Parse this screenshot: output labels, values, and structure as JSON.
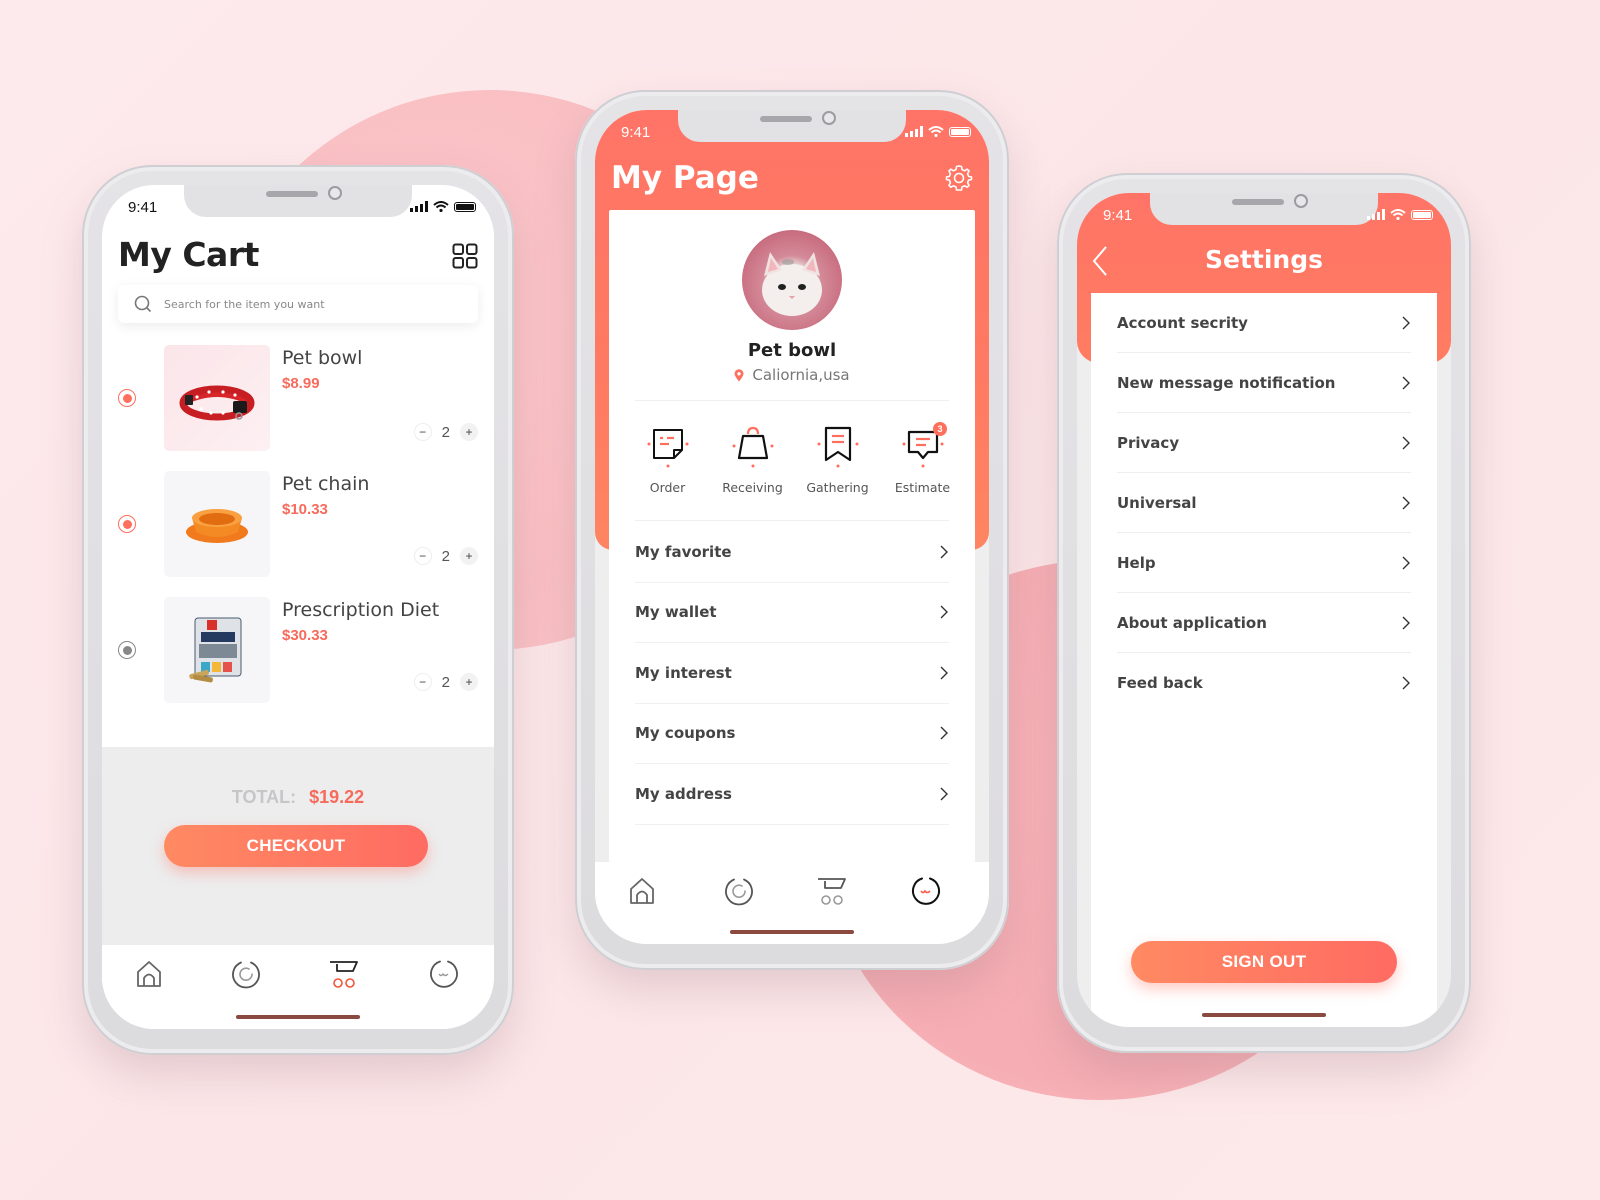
{
  "colors": {
    "accent": "#ff7466",
    "accent_gradient_start": "#ff8a62",
    "accent_gradient_end": "#ff6b62",
    "price": "#f76b5c",
    "home_indicator": "#8b4a3f"
  },
  "status_bar": {
    "time": "9:41"
  },
  "cart_screen": {
    "title": "My Cart",
    "view_toggle_icon": "grid-icon",
    "search": {
      "placeholder": "Search for the item you want",
      "value": ""
    },
    "items": [
      {
        "name": "Pet bowl",
        "price": "$8.99",
        "quantity": "2",
        "selected": true,
        "image": "red-collar"
      },
      {
        "name": "Pet chain",
        "price": "$10.33",
        "quantity": "2",
        "selected": true,
        "image": "orange-bowl"
      },
      {
        "name": "Prescription Diet",
        "price": "$30.33",
        "quantity": "2",
        "selected": false,
        "image": "food-bag"
      }
    ],
    "total_label": "TOTAL:",
    "total_value": "$19.22",
    "checkout_label": "CHECKOUT",
    "tabs": [
      {
        "icon": "home-icon",
        "active": false
      },
      {
        "icon": "discover-icon",
        "active": false
      },
      {
        "icon": "cart-icon",
        "active": true
      },
      {
        "icon": "profile-icon",
        "active": false
      }
    ]
  },
  "mypage_screen": {
    "title": "My Page",
    "settings_icon": "gear-icon",
    "profile": {
      "name": "Pet bowl",
      "location": "Caliornia,usa"
    },
    "quick_actions": [
      {
        "label": "Order",
        "icon": "order-icon"
      },
      {
        "label": "Receiving",
        "icon": "bag-icon"
      },
      {
        "label": "Gathering",
        "icon": "bookmark-icon"
      },
      {
        "label": "Estimate",
        "icon": "comment-icon",
        "badge": "3"
      }
    ],
    "menu": [
      {
        "label": "My favorite"
      },
      {
        "label": "My wallet"
      },
      {
        "label": "My interest"
      },
      {
        "label": "My coupons"
      },
      {
        "label": "My address"
      }
    ],
    "tabs": [
      {
        "icon": "home-icon",
        "active": false
      },
      {
        "icon": "discover-icon",
        "active": false
      },
      {
        "icon": "cart-icon",
        "active": false
      },
      {
        "icon": "profile-icon",
        "active": true
      }
    ]
  },
  "settings_screen": {
    "title": "Settings",
    "back_icon": "chevron-left-icon",
    "items": [
      {
        "label": "Account secrity"
      },
      {
        "label": "New message notification"
      },
      {
        "label": "Privacy"
      },
      {
        "label": "Universal"
      },
      {
        "label": "Help"
      },
      {
        "label": "About application"
      },
      {
        "label": "Feed back"
      }
    ],
    "sign_out_label": "SIGN OUT"
  }
}
